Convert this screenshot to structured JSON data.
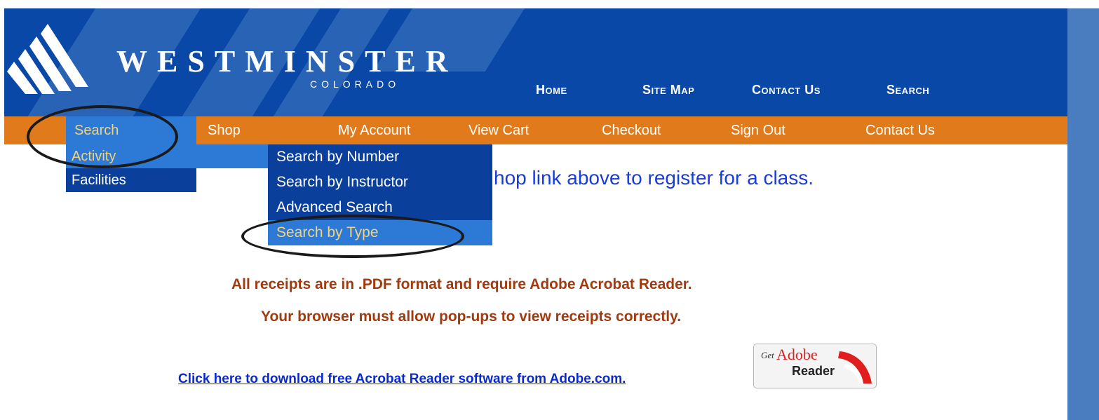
{
  "brand": {
    "name": "WESTMINSTER",
    "sub": "COLORADO"
  },
  "topnav": [
    {
      "label": "Home"
    },
    {
      "label": "Site Map"
    },
    {
      "label": "Contact Us"
    },
    {
      "label": "Search"
    }
  ],
  "navbar": [
    {
      "label": "Search"
    },
    {
      "label": "Shop"
    },
    {
      "label": "My Account"
    },
    {
      "label": "View Cart"
    },
    {
      "label": "Checkout"
    },
    {
      "label": "Sign Out"
    },
    {
      "label": "Contact Us"
    }
  ],
  "search_menu": [
    {
      "label": "Activity"
    },
    {
      "label": "Facilities"
    }
  ],
  "activity_submenu": [
    {
      "label": "Search by Number"
    },
    {
      "label": "Search by Instructor"
    },
    {
      "label": "Advanced Search"
    },
    {
      "label": "Search by Type"
    }
  ],
  "hint": "hop link above to register for a class.",
  "notes": [
    "All receipts are in .PDF format and require Adobe Acrobat Reader.",
    "Your browser must allow pop-ups to view receipts correctly."
  ],
  "download_link": "Click here to download free Acrobat Reader software from Adobe.com.",
  "badge": {
    "get": "Get",
    "adobe": "Adobe",
    "reader": "Reader"
  },
  "colors": {
    "header_blue": "#0a48a8",
    "nav_orange": "#e07a1b",
    "menu_blue": "#0a3f9c",
    "highlight": "#2c7ad6",
    "highlight_text": "#f4d27a",
    "note_text": "#a03a10",
    "link_text": "#0a2ad0"
  }
}
